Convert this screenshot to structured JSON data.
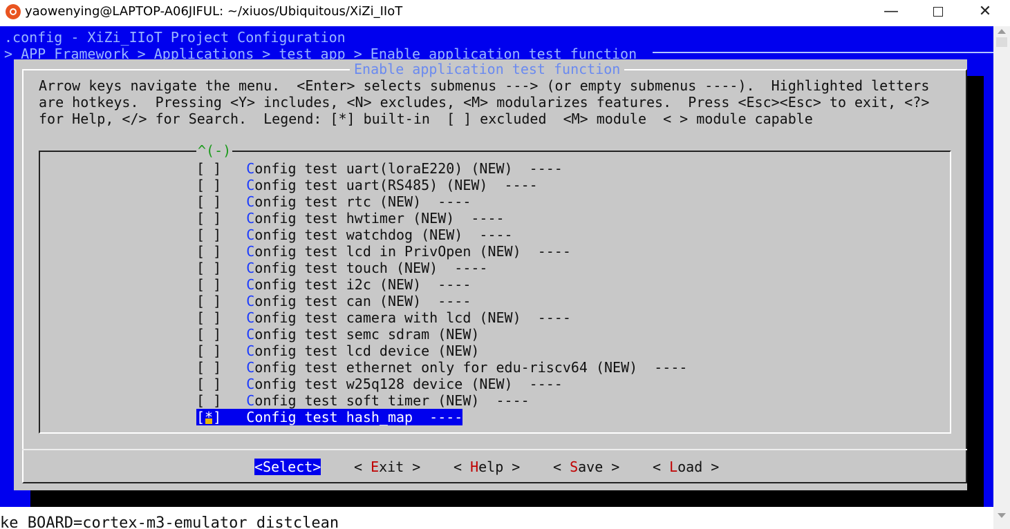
{
  "window": {
    "title": "yaowenying@LAPTOP-A06JIFUL: ~/xiuos/Ubiquitous/XiZi_IIoT",
    "minimize": "—",
    "close": "✕"
  },
  "terminal": {
    "config_title": ".config - XiZi_IIoT Project Configuration",
    "breadcrumb": "> APP_Framework > Applications > test app > Enable application test function",
    "previous_command": "ke BOARD=cortex-m3-emulator distclean"
  },
  "dialog": {
    "title": "Enable application test function",
    "help_lines": [
      "Arrow keys navigate the menu.  <Enter> selects submenus ---> (or empty submenus ----).  Highlighted letters",
      "are hotkeys.  Pressing <Y> includes, <N> excludes, <M> modularizes features.  Press <Esc><Esc> to exit, <?>",
      "for Help, </> for Search.  Legend: [*] built-in  [ ] excluded  <M> module  < > module capable"
    ],
    "scroll_indicator": "^(-)",
    "items": [
      {
        "checkbox": "[ ]",
        "hotkey": "C",
        "rest": "onfig test uart(loraE220) (NEW)  ----"
      },
      {
        "checkbox": "[ ]",
        "hotkey": "C",
        "rest": "onfig test uart(RS485) (NEW)  ----"
      },
      {
        "checkbox": "[ ]",
        "hotkey": "C",
        "rest": "onfig test rtc (NEW)  ----"
      },
      {
        "checkbox": "[ ]",
        "hotkey": "C",
        "rest": "onfig test hwtimer (NEW)  ----"
      },
      {
        "checkbox": "[ ]",
        "hotkey": "C",
        "rest": "onfig test watchdog (NEW)  ----"
      },
      {
        "checkbox": "[ ]",
        "hotkey": "C",
        "rest": "onfig test lcd in PrivOpen (NEW)  ----"
      },
      {
        "checkbox": "[ ]",
        "hotkey": "C",
        "rest": "onfig test touch (NEW)  ----"
      },
      {
        "checkbox": "[ ]",
        "hotkey": "C",
        "rest": "onfig test i2c (NEW)  ----"
      },
      {
        "checkbox": "[ ]",
        "hotkey": "C",
        "rest": "onfig test can (NEW)  ----"
      },
      {
        "checkbox": "[ ]",
        "hotkey": "C",
        "rest": "onfig test camera with lcd (NEW)  ----"
      },
      {
        "checkbox": "[ ]",
        "hotkey": "C",
        "rest": "onfig test semc sdram (NEW)"
      },
      {
        "checkbox": "[ ]",
        "hotkey": "C",
        "rest": "onfig test lcd device (NEW)"
      },
      {
        "checkbox": "[ ]",
        "hotkey": "C",
        "rest": "onfig test ethernet only for edu-riscv64 (NEW)  ----"
      },
      {
        "checkbox": "[ ]",
        "hotkey": "C",
        "rest": "onfig test w25q128 device (NEW)  ----"
      },
      {
        "checkbox": "[ ]",
        "hotkey": "C",
        "rest": "onfig test soft timer (NEW)  ----"
      }
    ],
    "selected_item": {
      "checkbox_open": "[",
      "checkbox_mark": "*",
      "checkbox_close": "]",
      "hotkey": "C",
      "rest": "onfig test hash_map  ----"
    },
    "buttons": {
      "select": "<Select>",
      "exit": {
        "left": "< ",
        "hotkey": "E",
        "rest": "xit >"
      },
      "help": {
        "left": "< ",
        "hotkey": "H",
        "rest": "elp >"
      },
      "save": {
        "left": "< ",
        "hotkey": "S",
        "rest": "ave >"
      },
      "load": {
        "left": "< ",
        "hotkey": "L",
        "rest": "oad >"
      }
    }
  }
}
